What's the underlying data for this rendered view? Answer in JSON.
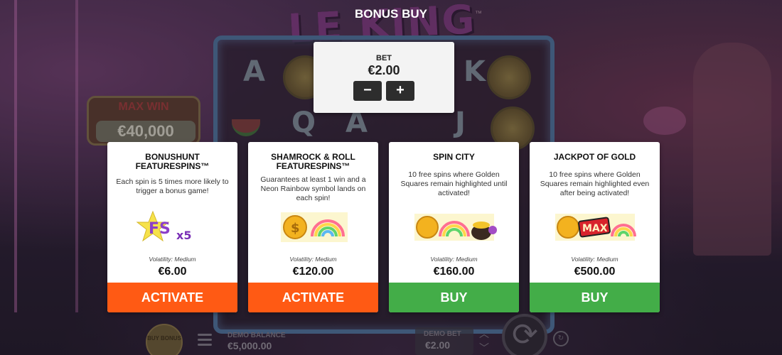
{
  "title": "BONUS BUY",
  "bet": {
    "label": "BET",
    "value": "€2.00",
    "minus": "−",
    "plus": "+"
  },
  "cards": [
    {
      "name": "BONUSHUNT FEATURESPINS™",
      "description": "Each spin is 5 times more likely to trigger a bonus game!",
      "volatility": "Volatility: Medium",
      "price": "€6.00",
      "action": "ACTIVATE",
      "action_color": "#ff5a14"
    },
    {
      "name": "SHAMROCK & ROLL FEATURESPINS™",
      "description": "Guarantees at least 1 win and a Neon Rainbow symbol lands on each spin!",
      "volatility": "Volatility: Medium",
      "price": "€120.00",
      "action": "ACTIVATE",
      "action_color": "#ff5a14"
    },
    {
      "name": "SPIN CITY",
      "description": "10 free spins where Golden Squares remain highlighted until activated!",
      "volatility": "Volatility: Medium",
      "price": "€160.00",
      "action": "BUY",
      "action_color": "#43ad48"
    },
    {
      "name": "JACKPOT OF GOLD",
      "description": "10 free spins where Golden Squares remain highlighted even after being activated!",
      "volatility": "Volatility: Medium",
      "price": "€500.00",
      "action": "BUY",
      "action_color": "#43ad48"
    }
  ],
  "game": {
    "logo": "LE KING",
    "logo_tm": "™",
    "max_win_label": "MAX WIN",
    "max_win_value": "€40,000",
    "buy_bonus": "BUY BONUS",
    "demo_balance_label": "DEMO BALANCE",
    "demo_balance_value": "€5,000.00",
    "demo_bet_label": "DEMO BET",
    "demo_bet_value": "€2.00"
  },
  "art": {
    "fs": "FS",
    "fs_multiplier": "x5",
    "max": "MAX"
  }
}
